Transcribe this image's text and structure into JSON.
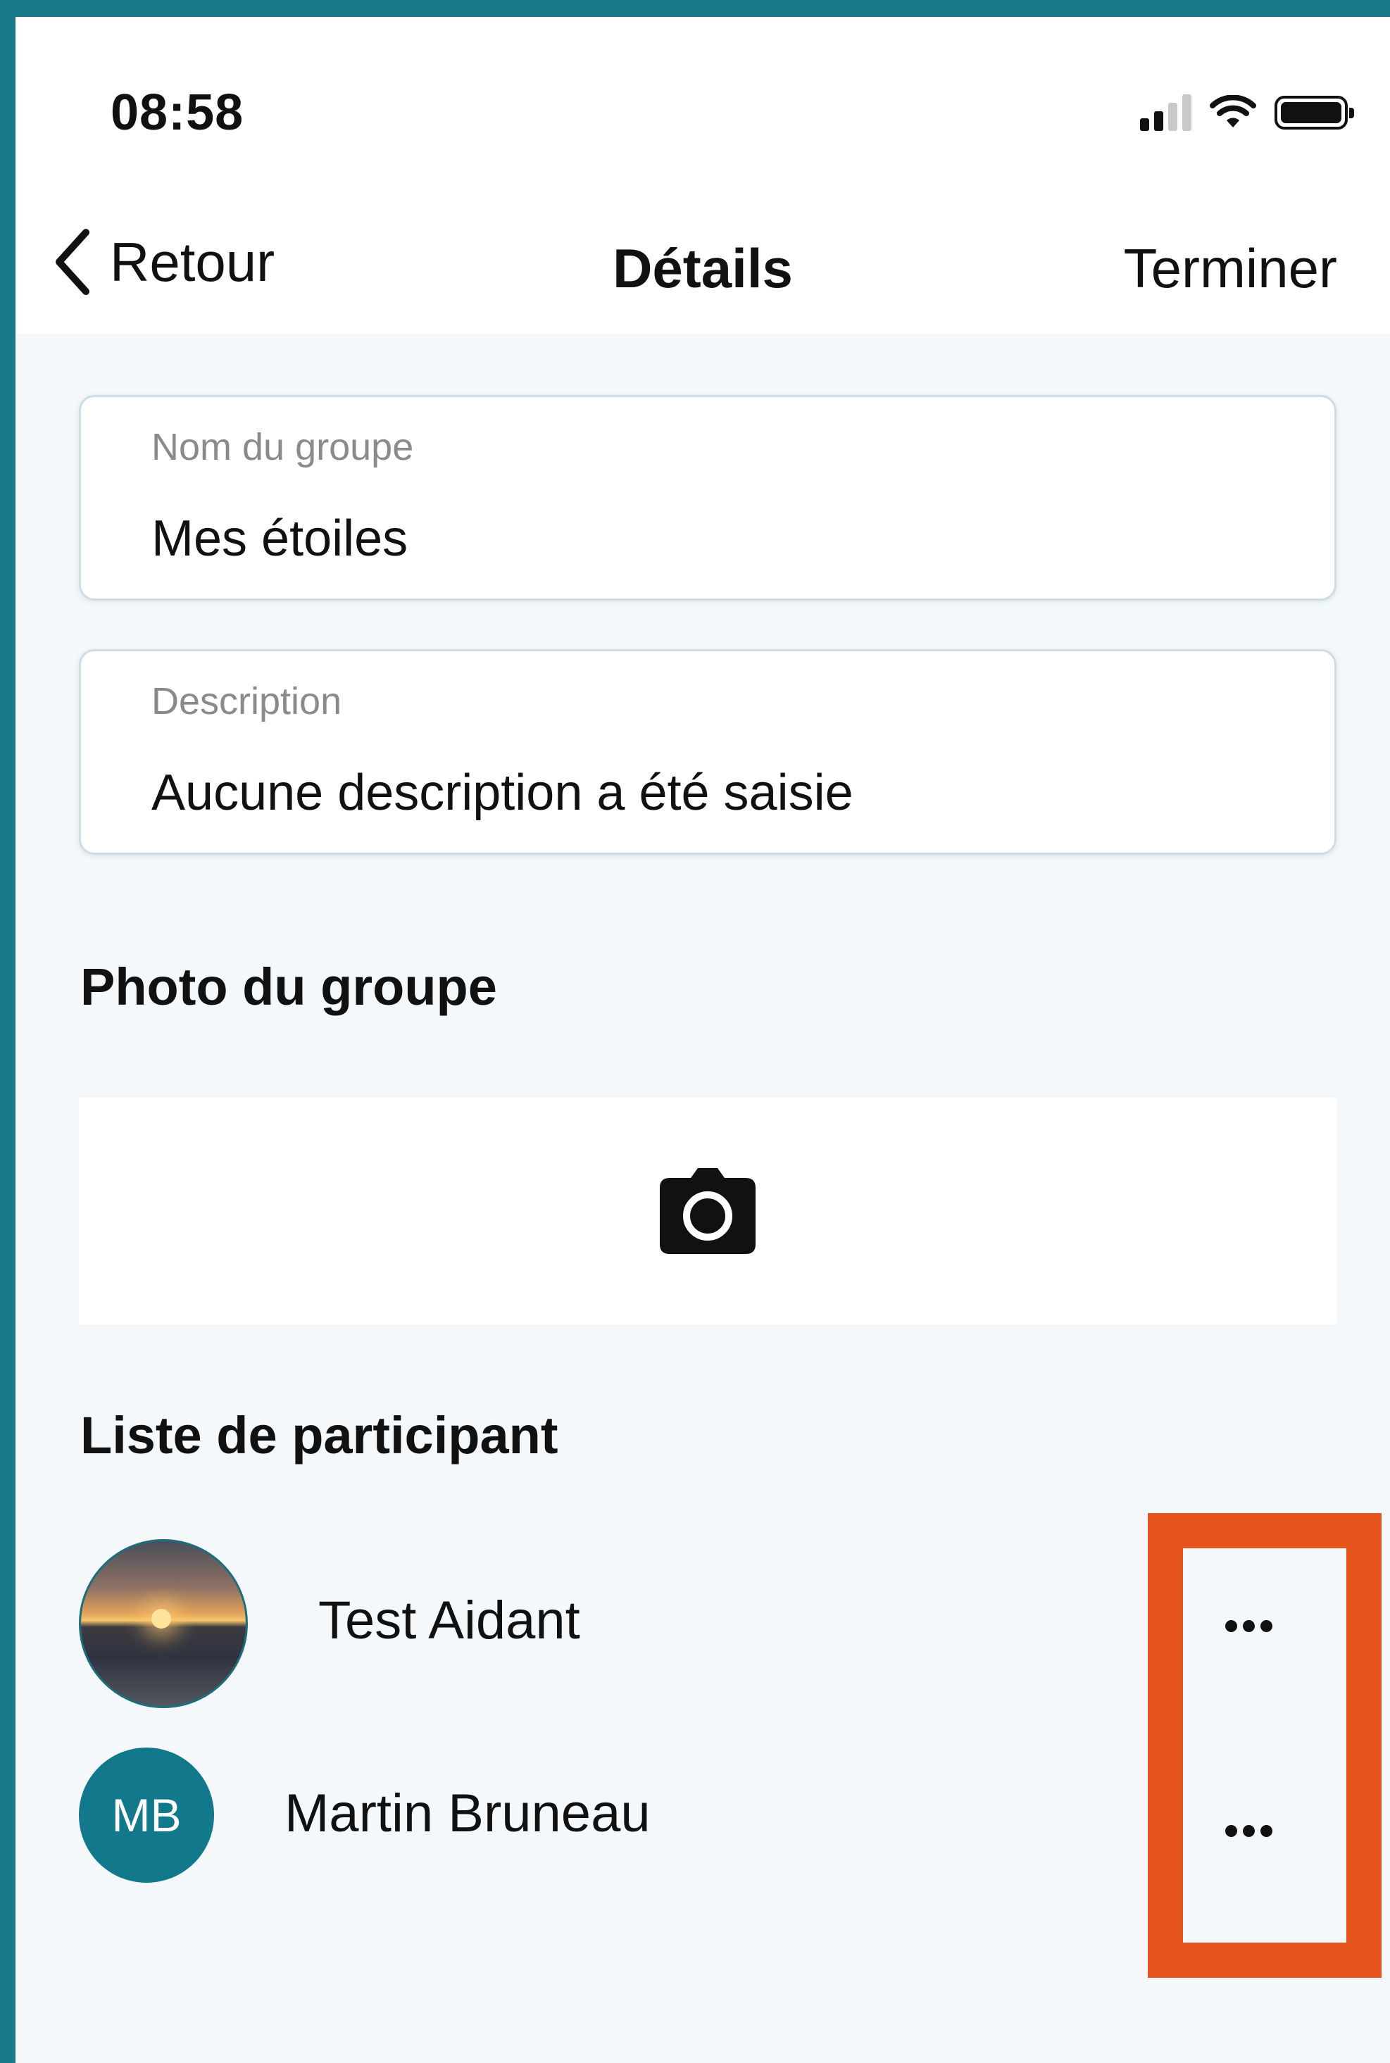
{
  "status_bar": {
    "time": "08:58",
    "icons": [
      "cellular-signal-icon",
      "wifi-icon",
      "battery-icon"
    ]
  },
  "nav": {
    "back_label": "Retour",
    "title": "Détails",
    "done_label": "Terminer"
  },
  "form": {
    "group_name": {
      "label": "Nom du groupe",
      "value": "Mes étoiles"
    },
    "description": {
      "label": "Description",
      "value": "Aucune description a été saisie"
    }
  },
  "photo_section": {
    "title": "Photo du groupe",
    "icon": "camera-icon"
  },
  "participants_section": {
    "title": "Liste de participant",
    "items": [
      {
        "name": "Test Aidant",
        "avatar": "photo",
        "menu_icon": "more-horizontal-icon"
      },
      {
        "name": "Martin Bruneau",
        "initials": "MB",
        "avatar": "initials",
        "menu_icon": "more-horizontal-icon"
      }
    ]
  },
  "colors": {
    "frame": "#1a7a8a",
    "background": "#f4f8fb",
    "avatar_initials_bg": "#12798d",
    "highlight": "#e8541e"
  }
}
